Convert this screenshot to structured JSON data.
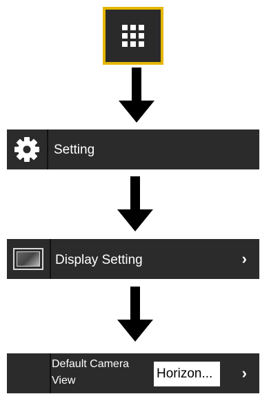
{
  "rows": {
    "setting": {
      "label": "Setting",
      "icon": "gear-icon"
    },
    "display": {
      "label": "Display Setting",
      "icon": "display-icon",
      "chevron": "›"
    },
    "camera": {
      "label": "Default Camera View",
      "value": "Horizon...",
      "chevron": "›"
    }
  },
  "colors": {
    "accent": "#e4b600",
    "row_background": "#2b2b2b",
    "text": "#ffffff"
  }
}
